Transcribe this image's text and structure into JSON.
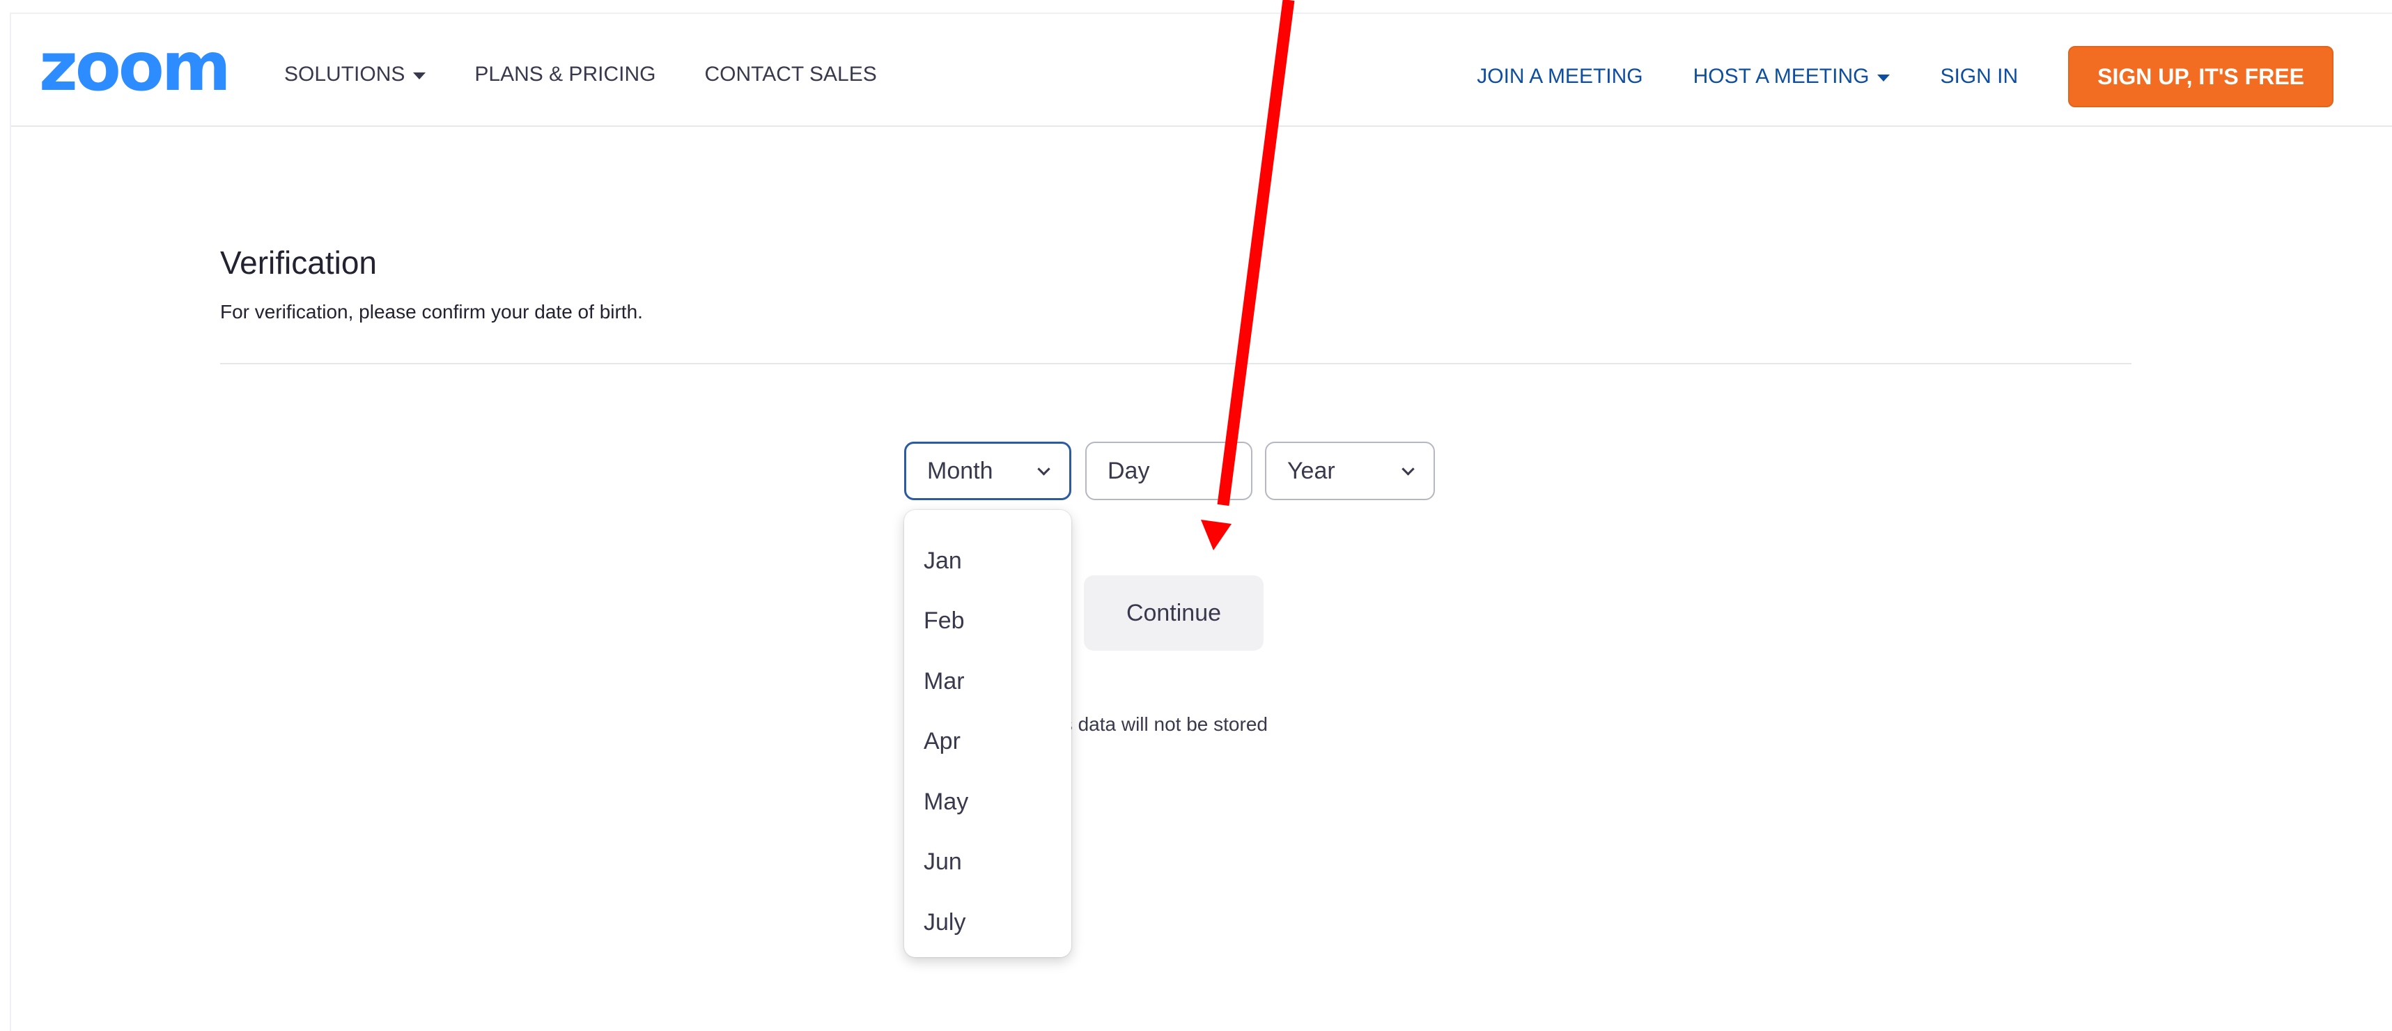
{
  "header": {
    "logo": "zoom",
    "nav_left": [
      {
        "label": "SOLUTIONS",
        "has_caret": true
      },
      {
        "label": "PLANS & PRICING",
        "has_caret": false
      },
      {
        "label": "CONTACT SALES",
        "has_caret": false
      }
    ],
    "nav_right": [
      {
        "label": "JOIN A MEETING",
        "has_caret": false
      },
      {
        "label": "HOST A MEETING",
        "has_caret": true
      },
      {
        "label": "SIGN IN",
        "has_caret": false
      }
    ],
    "signup_label": "SIGN UP, IT'S FREE"
  },
  "verification": {
    "title": "Verification",
    "subtitle": "For verification, please confirm your date of birth."
  },
  "date_fields": {
    "month_placeholder": "Month",
    "day_placeholder": "Day",
    "year_placeholder": "Year"
  },
  "continue_label": "Continue",
  "note": "his data will not be stored",
  "month_dropdown": {
    "options": [
      "Jan",
      "Feb",
      "Mar",
      "Apr",
      "May",
      "Jun",
      "July"
    ]
  },
  "colors": {
    "brand_blue": "#2d8cff",
    "nav_blue": "#0e4ea0",
    "signup_orange": "#f26d21",
    "annotation_red": "#ff0000"
  },
  "icons": {
    "caret": "caret-down-icon",
    "chevron": "chevron-down-icon",
    "annotation": "red-arrow-annotation"
  }
}
